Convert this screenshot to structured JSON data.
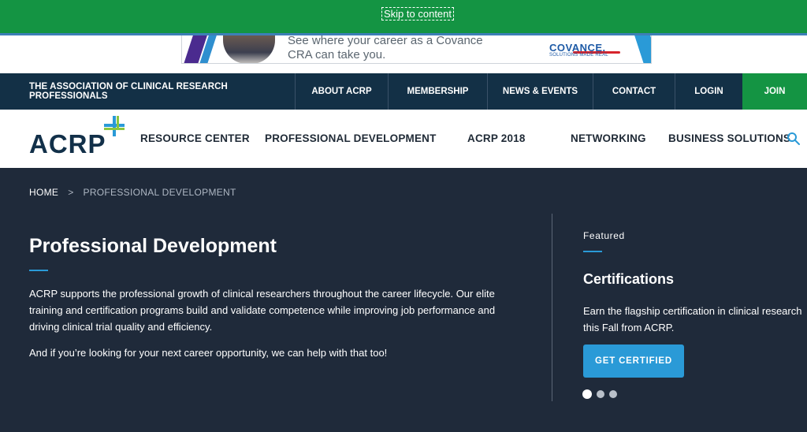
{
  "skip": {
    "label": "Skip to content"
  },
  "ad": {
    "line1": "See where your career as a Covance",
    "line2": "CRA can take you.",
    "brand": "COVANCE.",
    "tagline": "SOLUTIONS MADE REAL"
  },
  "topnav": {
    "org": "THE ASSOCIATION OF CLINICAL RESEARCH PROFESSIONALS",
    "items": [
      {
        "label": "ABOUT ACRP"
      },
      {
        "label": "MEMBERSHIP"
      },
      {
        "label": "NEWS & EVENTS"
      },
      {
        "label": "CONTACT"
      },
      {
        "label": "LOGIN"
      },
      {
        "label": "JOIN"
      }
    ]
  },
  "mainnav": {
    "logo": "ACRP",
    "items": [
      {
        "label": "RESOURCE CENTER"
      },
      {
        "label": "PROFESSIONAL DEVELOPMENT"
      },
      {
        "label": "ACRP 2018"
      },
      {
        "label": "NETWORKING"
      },
      {
        "label": "BUSINESS SOLUTIONS"
      }
    ],
    "search_icon": "search-icon"
  },
  "breadcrumb": {
    "home": "HOME",
    "separator": ">",
    "current": "PROFESSIONAL DEVELOPMENT"
  },
  "hero": {
    "title": "Professional Development",
    "paragraph1": "ACRP supports the professional growth of clinical researchers throughout the career lifecycle. Our elite training and certification programs build and validate competence while improving job performance and driving clinical trial quality and efficiency.",
    "paragraph2": "And if you’re looking for your next career opportunity, we can help with that too!"
  },
  "featured": {
    "label": "Featured",
    "title": "Certifications",
    "text": "Earn the flagship certification in clinical research this Fall from ACRP.",
    "cta": "GET CERTIFIED",
    "slides": 3,
    "active_slide": 1
  },
  "colors": {
    "skip_bar": "#149443",
    "top_nav": "#133046",
    "join": "#149443",
    "hero_bg": "#1f2a3a",
    "accent": "#2a9ad7"
  }
}
